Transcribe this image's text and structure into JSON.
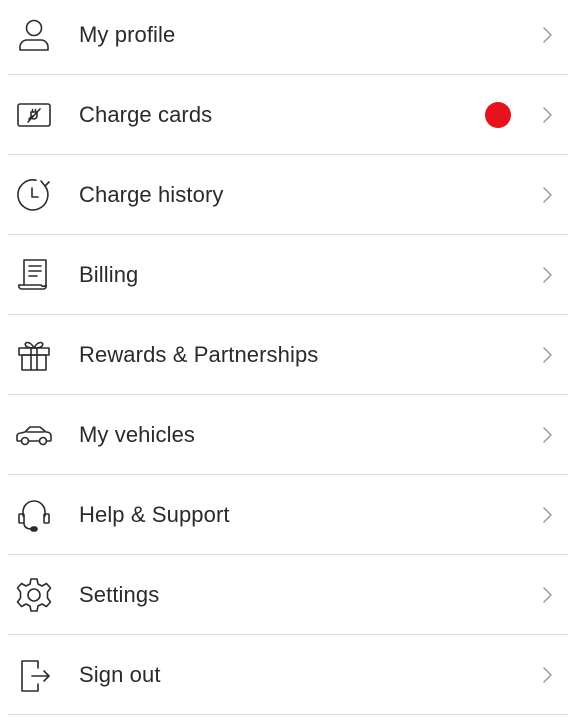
{
  "colors": {
    "badge": "#e8121c",
    "divider": "#dcdcdc",
    "chevron": "#9a9a9a",
    "text": "#2b2b2b"
  },
  "menu": {
    "items": [
      {
        "label": "My profile",
        "icon": "profile-icon"
      },
      {
        "label": "Charge cards",
        "icon": "charge-card-icon",
        "badge": true
      },
      {
        "label": "Charge history",
        "icon": "history-icon"
      },
      {
        "label": "Billing",
        "icon": "billing-icon"
      },
      {
        "label": "Rewards & Partnerships",
        "icon": "gift-icon"
      },
      {
        "label": "My vehicles",
        "icon": "car-icon"
      },
      {
        "label": "Help & Support",
        "icon": "headset-icon"
      },
      {
        "label": "Settings",
        "icon": "gear-icon"
      },
      {
        "label": "Sign out",
        "icon": "sign-out-icon"
      }
    ]
  }
}
